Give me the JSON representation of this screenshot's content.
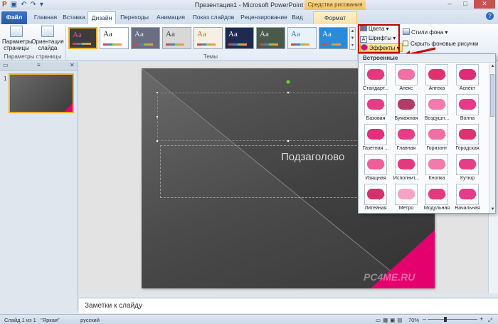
{
  "titlebar": {
    "window_title": "Презентация1 - Microsoft PowerPoint",
    "context_tab_title": "Средства рисования",
    "quick_access": [
      "save-icon",
      "undo-icon",
      "redo-icon"
    ],
    "window_buttons": [
      "–",
      "□",
      "✕"
    ]
  },
  "tabs": [
    {
      "label": "Файл"
    },
    {
      "label": "Главная"
    },
    {
      "label": "Вставка"
    },
    {
      "label": "Дизайн"
    },
    {
      "label": "Переходы"
    },
    {
      "label": "Анимация"
    },
    {
      "label": "Показ слайдов"
    },
    {
      "label": "Рецензирование"
    },
    {
      "label": "Вид"
    },
    {
      "label": "Формат"
    }
  ],
  "ribbon": {
    "page_setup": {
      "params_label": "Параметры страницы",
      "orientation_label": "Ориентация слайда",
      "group_label": "Параметры страницы"
    },
    "themes_group_label": "Темы",
    "themes": [
      {
        "text": "Aa",
        "bg": "#3c3c3c",
        "fg": "#d060a0"
      },
      {
        "text": "Aa",
        "bg": "#ffffff",
        "fg": "#222222"
      },
      {
        "text": "Aa",
        "bg": "#6a6e80",
        "fg": "#e8e8f0"
      },
      {
        "text": "Aa",
        "bg": "#d8d8d8",
        "fg": "#333333"
      },
      {
        "text": "Aa",
        "bg": "#f6efe4",
        "fg": "#d2691e"
      },
      {
        "text": "Aa",
        "bg": "#1f2a50",
        "fg": "#ffffff"
      },
      {
        "text": "Aa",
        "bg": "#4a5a4a",
        "fg": "#f0f0e0"
      },
      {
        "text": "Aa",
        "bg": "#e8f2fb",
        "fg": "#2a6db0"
      },
      {
        "text": "Aa",
        "bg": "#2b8bd8",
        "fg": "#ffffff"
      }
    ],
    "colors_label": "Цвета",
    "fonts_label": "Шрифты",
    "effects_label": "Эффекты",
    "bg_styles_label": "Стили фона",
    "hide_bg_label": "Скрыть фоновые рисунки"
  },
  "thumbnails": {
    "tab_slides": "▭",
    "tab_outline": "≡",
    "close": "✕",
    "slide_number": "1"
  },
  "slide": {
    "subtitle": "Подзаголово",
    "watermark": "PC4ME.RU"
  },
  "notes": {
    "placeholder": "Заметки к слайду"
  },
  "status": {
    "slide_info": "Слайд 1 из 1",
    "theme": "\"Яркая\"",
    "language": "русский",
    "zoom": "70%"
  },
  "effects_dropdown": {
    "header": "Встроенные",
    "items": [
      {
        "label": "Стандарт...",
        "color": "#e5387f"
      },
      {
        "label": "Апекс",
        "color": "#f06fa5"
      },
      {
        "label": "Аптека",
        "color": "#e0306f"
      },
      {
        "label": "Аспект",
        "color": "#e02a78"
      },
      {
        "label": "Базовая",
        "color": "#e53d86"
      },
      {
        "label": "Бумажная",
        "color": "#b43a6a"
      },
      {
        "label": "Воздушн...",
        "color": "#f27aad"
      },
      {
        "label": "Волна",
        "color": "#e83a8a"
      },
      {
        "label": "Газетная ...",
        "color": "#e12f7a"
      },
      {
        "label": "Главная",
        "color": "#e53d86"
      },
      {
        "label": "Горизонт",
        "color": "#f06fa5"
      },
      {
        "label": "Городская",
        "color": "#e0306f"
      },
      {
        "label": "Изящная",
        "color": "#f05e9a"
      },
      {
        "label": "Исполнит...",
        "color": "#e5387f"
      },
      {
        "label": "Кнопка",
        "color": "#f27aad"
      },
      {
        "label": "Кутюр",
        "color": "#e53d86"
      },
      {
        "label": "Литейная",
        "color": "#d8306f"
      },
      {
        "label": "Метро",
        "color": "#f7a3c6"
      },
      {
        "label": "Модульная",
        "color": "#e5387f"
      },
      {
        "label": "Начальная",
        "color": "#e83a8a"
      }
    ]
  }
}
